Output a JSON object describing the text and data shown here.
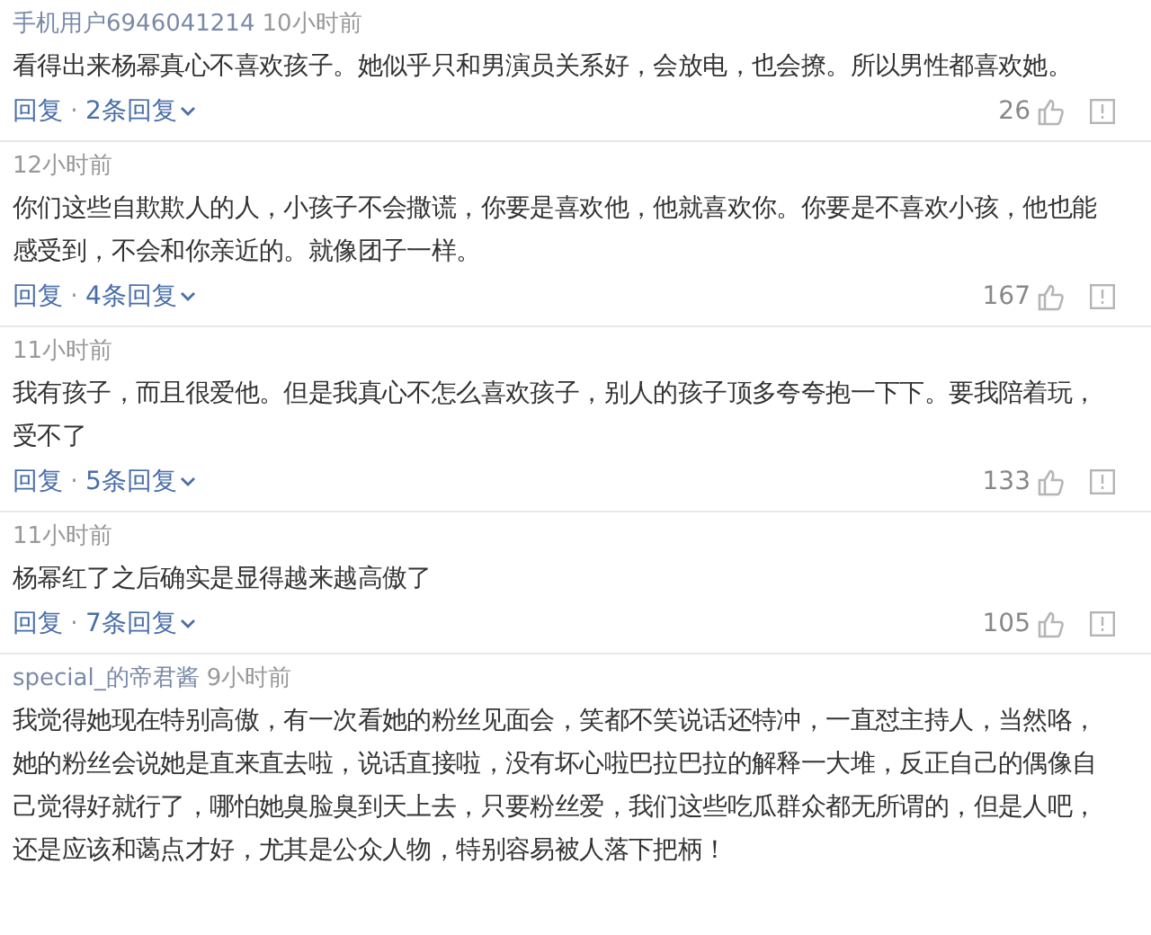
{
  "comments": [
    {
      "user": "手机用户6946041214",
      "time": "10小时前",
      "text": "看得出来杨幂真心不喜欢孩子。她似乎只和男演员关系好，会放电，也会撩。所以男性都喜欢她。",
      "reply": "回复",
      "sep": "·",
      "replies": "2条回复",
      "likes": "26"
    },
    {
      "time": "12小时前",
      "text": "你们这些自欺欺人的人，小孩子不会撒谎，你要是喜欢他，他就喜欢你。你要是不喜欢小孩，他也能感受到，不会和你亲近的。就像团子一样。",
      "reply": "回复",
      "sep": "·",
      "replies": "4条回复",
      "likes": "167"
    },
    {
      "time": "11小时前",
      "text": "我有孩子，而且很爱他。但是我真心不怎么喜欢孩子，别人的孩子顶多夸夸抱一下下。要我陪着玩，受不了",
      "reply": "回复",
      "sep": "·",
      "replies": "5条回复",
      "likes": "133"
    },
    {
      "time": "11小时前",
      "text": "杨幂红了之后确实是显得越来越高傲了",
      "reply": "回复",
      "sep": "·",
      "replies": "7条回复",
      "likes": "105"
    },
    {
      "user": "special_的帝君酱",
      "time": "9小时前",
      "text": "我觉得她现在特别高傲，有一次看她的粉丝见面会，笑都不笑说话还特冲，一直怼主持人，当然咯，她的粉丝会说她是直来直去啦，说话直接啦，没有坏心啦巴拉巴拉的解释一大堆，反正自己的偶像自己觉得好就行了，哪怕她臭脸臭到天上去，只要粉丝爱，我们这些吃瓜群众都无所谓的，但是人吧，还是应该和蔼点才好，尤其是公众人物，特别容易被人落下把柄！"
    }
  ]
}
